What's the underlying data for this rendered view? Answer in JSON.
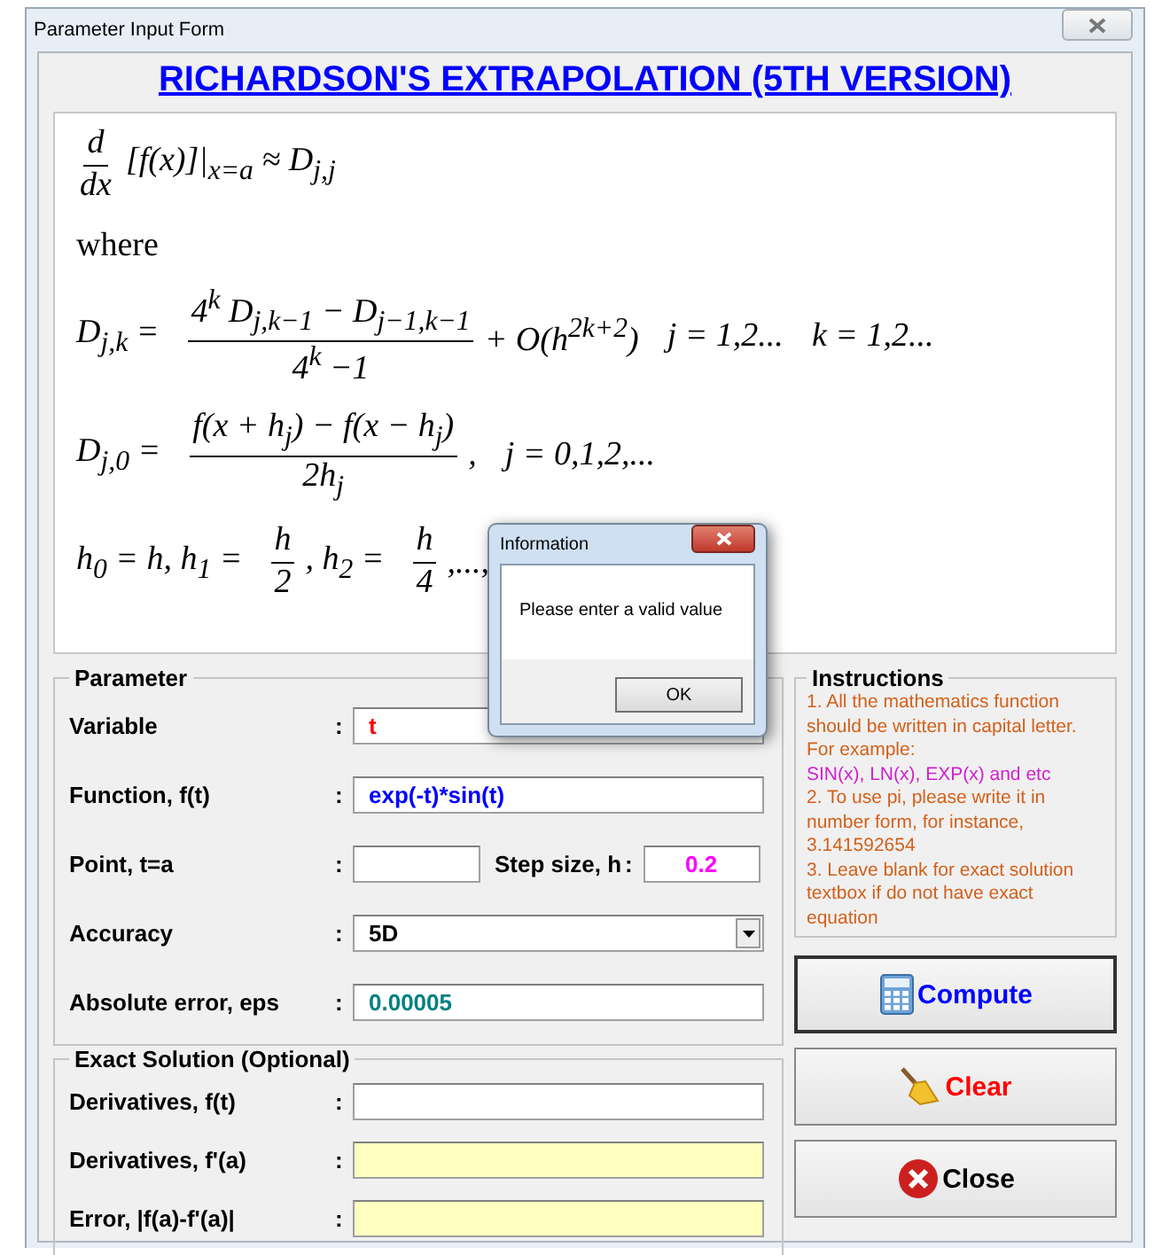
{
  "window": {
    "title": "Parameter Input Form"
  },
  "heading": "RICHARDSON'S EXTRAPOLATION (5TH VERSION)",
  "formula": [
    [
      {
        "kind": "frac",
        "num": "d",
        "den": "dx"
      },
      {
        "kind": "math",
        "text": "[f(x)]|$_{x=a}$ ≈ D$_{j,j}$"
      }
    ],
    [
      {
        "kind": "word",
        "text": "where"
      }
    ],
    [
      {
        "kind": "math",
        "text": "D$_{j,k}$ ="
      },
      {
        "kind": "frac",
        "num": "4$^{k}$ D$_{j,k−1}$ − D$_{j−1,k−1}$",
        "den": "4$^{k}$ −1"
      },
      {
        "kind": "math",
        "text": "+ O(h$^{2k+2}$)"
      },
      {
        "kind": "math",
        "text": "j = 1,2..."
      },
      {
        "kind": "math",
        "text": "k = 1,2..."
      }
    ],
    [
      {
        "kind": "math",
        "text": "D$_{j,0}$ ="
      },
      {
        "kind": "frac",
        "num": "f(x + h$_{j}$) − f(x − h$_{j}$)",
        "den": "2h$_{j}$"
      },
      {
        "kind": "math",
        "text": ","
      },
      {
        "kind": "math",
        "text": "j = 0,1,2,..."
      }
    ],
    [
      {
        "kind": "math",
        "text": "h$_{0}$ = h, h$_{1}$ ="
      },
      {
        "kind": "frac",
        "num": "h",
        "den": "2"
      },
      {
        "kind": "math",
        "text": ", h$_{2}$ ="
      },
      {
        "kind": "frac",
        "num": "h",
        "den": "4"
      },
      {
        "kind": "math",
        "text": ",...,"
      }
    ]
  ],
  "parameter": {
    "legend": "Parameter",
    "rows": [
      {
        "label": "Variable",
        "sep": ":",
        "fields": [
          {
            "kind": "text",
            "value": "t",
            "color": "#ff0000",
            "readonly": false
          }
        ]
      },
      {
        "label": "Function, f(t)",
        "sep": ":",
        "fields": [
          {
            "kind": "text",
            "value": "exp(-t)*sin(t)",
            "color": "#0000ff",
            "readonly": false
          }
        ]
      },
      {
        "label": "Point,  t=a",
        "sep": ":",
        "fields": [
          {
            "kind": "short",
            "readonly": false
          },
          {
            "kind": "short",
            "label": "Step size, h",
            "sep": ":",
            "value": "0.2",
            "color": "#ff00ff",
            "readonly": false
          }
        ]
      },
      {
        "label": "Accuracy",
        "sep": ":",
        "fields": [
          {
            "kind": "dropdown",
            "value": "5D",
            "color": "#000000"
          }
        ]
      },
      {
        "label": "Absolute error, eps",
        "sep": ":",
        "fields": [
          {
            "kind": "text",
            "value": "0.00005",
            "color": "#008080",
            "readonly": false
          }
        ]
      }
    ]
  },
  "exact": {
    "legend": "Exact Solution (Optional)",
    "rows": [
      {
        "label": "Derivatives, f(t)",
        "sep": ":",
        "fields": [
          {
            "kind": "text",
            "readonly": false
          }
        ]
      },
      {
        "label": "Derivatives, f'(a)",
        "sep": ":",
        "fields": [
          {
            "kind": "text",
            "readonly": true
          }
        ]
      },
      {
        "label": "Error, |f(a)-f'(a)|",
        "sep": ":",
        "fields": [
          {
            "kind": "text",
            "readonly": true
          }
        ]
      }
    ]
  },
  "instructions": {
    "legend": "Instructions",
    "lines": [
      {
        "kind": "note",
        "text": "1. All the mathematics function should be written in capital letter."
      },
      {
        "kind": "note",
        "text": "For example:"
      },
      {
        "kind": "example",
        "text": "SIN(x), LN(x), EXP(x) and etc"
      },
      {
        "kind": "note",
        "text": "2. To use pi, please write it in number form, for instance, 3.141592654"
      },
      {
        "kind": "note",
        "text": "3. Leave blank for exact solution textbox if do not have exact equation"
      }
    ]
  },
  "buttons": [
    {
      "kind": "compute",
      "label": "Compute"
    },
    {
      "kind": "clear",
      "label": "Clear"
    },
    {
      "kind": "close",
      "label": "Close"
    }
  ],
  "dialog": {
    "title": "Information",
    "message": "Please enter a valid value",
    "button": "OK"
  }
}
